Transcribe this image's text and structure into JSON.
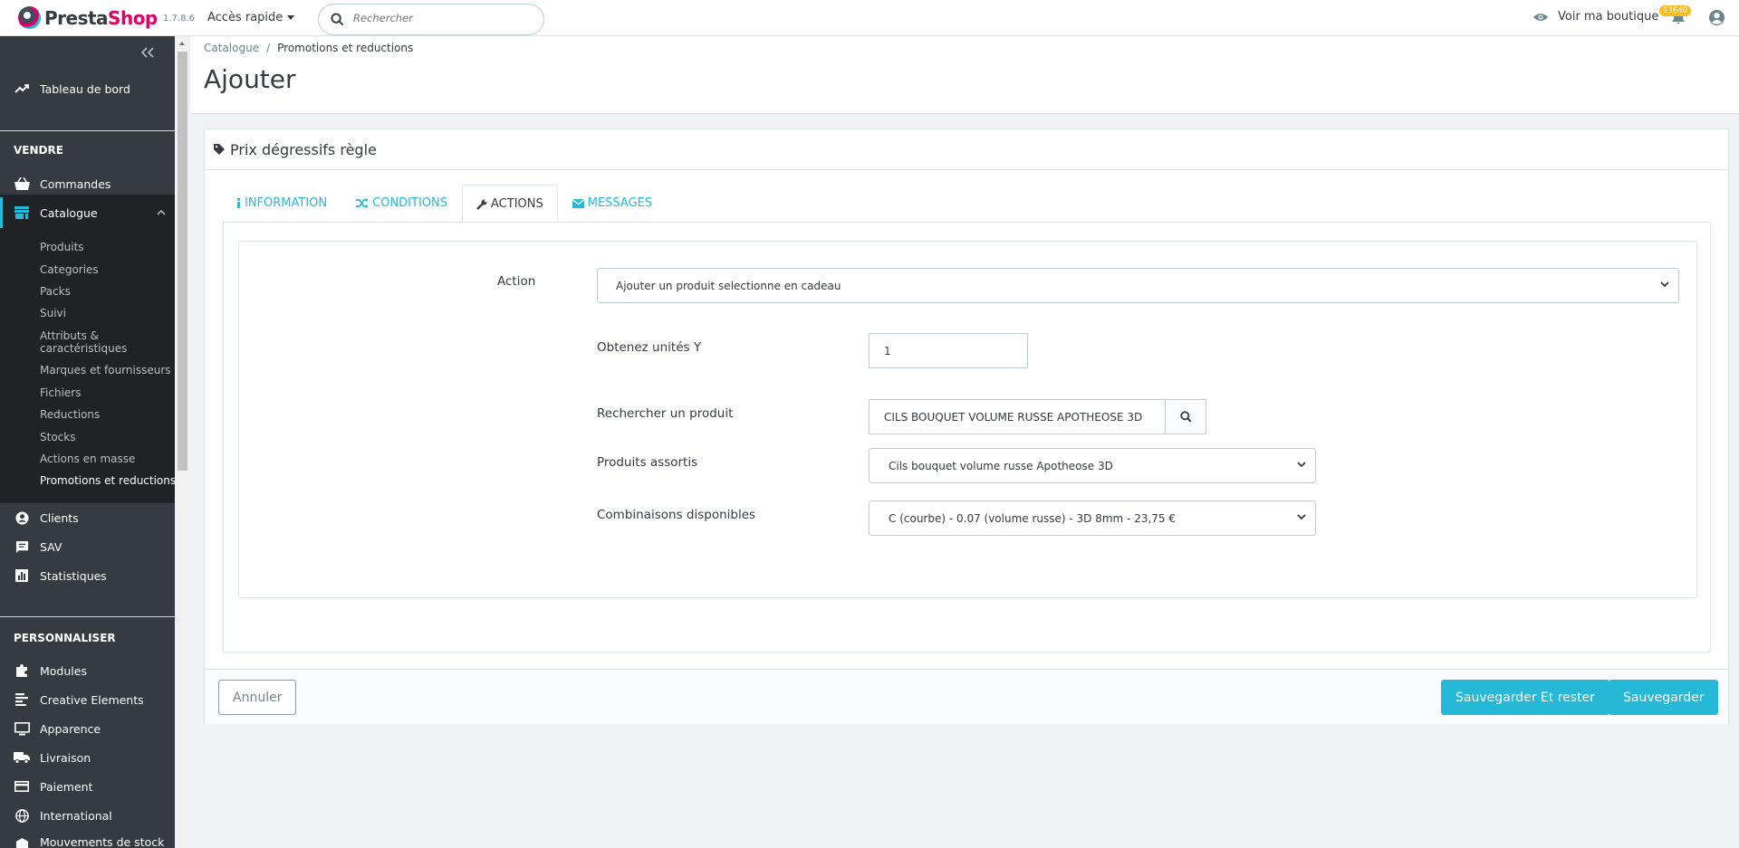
{
  "header": {
    "logo_text_presta": "Presta",
    "logo_text_shop": "Shop",
    "version": "1.7.8.6",
    "quick_access": "Accès rapide",
    "search_placeholder": "Rechercher",
    "visit_shop": "Voir ma boutique",
    "notification_count": "13640"
  },
  "sidebar": {
    "dashboard": "Tableau de bord",
    "section_sell": "VENDRE",
    "orders": "Commandes",
    "catalog": "Catalogue",
    "catalog_sub": [
      "Produits",
      "Categories",
      "Packs",
      "Suivi",
      "Attributs &",
      "caractéristiques",
      "Marques et fournisseurs",
      "Fichiers",
      "Reductions",
      "Stocks",
      "Actions en masse",
      "Promotions et reductions"
    ],
    "customers": "Clients",
    "support": "SAV",
    "stats": "Statistiques",
    "section_customize": "PERSONNALISER",
    "modules": "Modules",
    "creative": "Creative Elements",
    "appearance": "Apparence",
    "shipping": "Livraison",
    "payment": "Paiement",
    "international": "International",
    "stock_moves": "Mouvements de stock"
  },
  "breadcrumb": {
    "parent": "Catalogue",
    "separator": "/",
    "current": "Promotions et reductions"
  },
  "page_title": "Ajouter",
  "panel": {
    "heading": "Prix dégressifs règle",
    "tabs": [
      "INFORMATION",
      "CONDITIONS",
      "ACTIONS",
      "MESSAGES"
    ],
    "active_tab": "ACTIONS",
    "form": {
      "action_label": "Action",
      "action_value": "Ajouter un produit selectionne en cadeau",
      "units_label": "Obtenez unités Y",
      "units_value": "1",
      "search_label": "Rechercher un produit",
      "search_value": "CILS BOUQUET VOLUME RUSSE APOTHEOSE 3D",
      "matched_label": "Produits assortis",
      "matched_value": "Cils bouquet volume russe Apotheose 3D",
      "combos_label": "Combinaisons disponibles",
      "combos_value": "C (courbe) - 0.07 (volume russe) - 3D 8mm - 23,75 €"
    },
    "footer": {
      "cancel": "Annuler",
      "save_stay": "Sauvegarder Et rester",
      "save": "Sauvegarder"
    }
  },
  "colors": {
    "accent": "#25b9d7",
    "sidebar_bg": "#363a41",
    "brand_pink": "#df0067",
    "badge": "#fbbb22"
  }
}
